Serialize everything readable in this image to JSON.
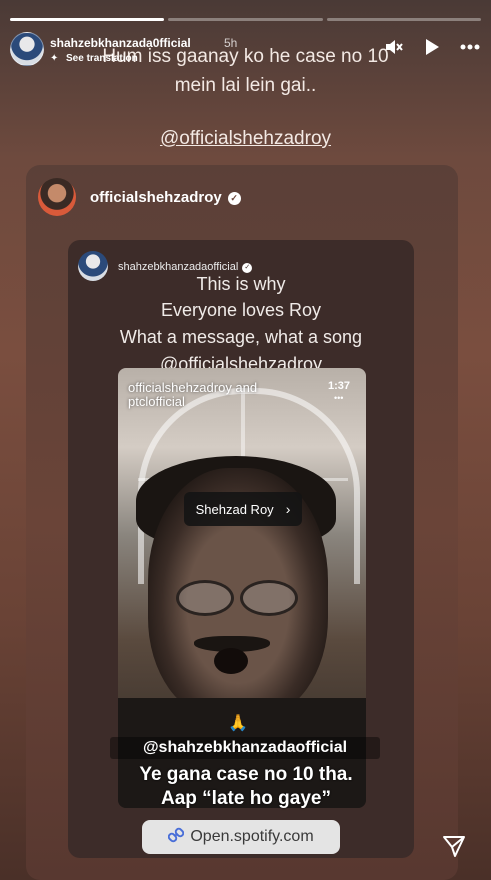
{
  "story": {
    "progress_segments": 3,
    "progress_active": 1,
    "header": {
      "username": "shahzebkhanzada0fficial",
      "time": "5h",
      "translate_label": "See translation"
    },
    "caption": {
      "line1": "Hum iss gaanay ko he case no 10",
      "line2": "mein lai lein gai..",
      "mention": "@officialshehzadroy"
    },
    "reshare": {
      "username": "officialshehzadroy",
      "inner": {
        "username": "shahzebkhanzadaofficial",
        "lines": [
          "This is why",
          "Everyone loves Roy",
          "What a message, what a song",
          "@officialshehzadroy"
        ],
        "video": {
          "overlay_user": "officialshehzadroy and ptclofficial",
          "time": "1:37",
          "tag_label": "Shehzad Roy",
          "emoji": "🙏",
          "caption_mention": "@shahzebkhanzadaofficial",
          "caption_line1": "Ye gana case no 10 tha.",
          "caption_line2": "Aap “late ho gaye”"
        },
        "link": "Open.spotify.com"
      }
    }
  },
  "colors": {
    "background": "#6e4a3e",
    "card": "#3d2c29",
    "link_sticker": "#e4e4e4"
  },
  "icons": [
    "mute-icon",
    "play-icon",
    "more-icon",
    "verified-icon",
    "link-icon",
    "send-icon"
  ]
}
